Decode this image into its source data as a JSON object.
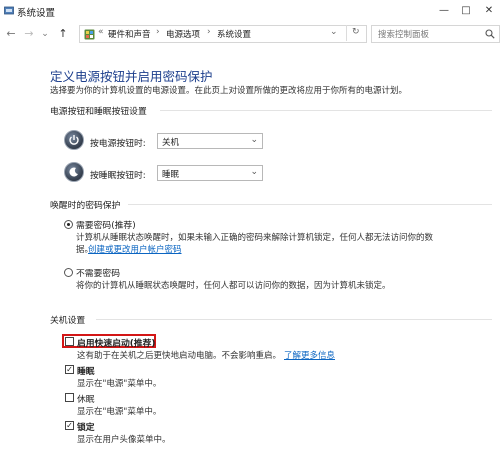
{
  "window": {
    "title": "系统设置",
    "minimize_label": "—",
    "maximize_label": "□",
    "close_label": "✕"
  },
  "nav": {
    "back_label": "←",
    "forward_label": "→",
    "recent_label": "⌄",
    "up_label": "↑",
    "breadcrumb_prefix": "«",
    "breadcrumb": [
      "硬件和声音",
      "电源选项",
      "系统设置"
    ],
    "breadcrumb_separator": "›",
    "dropdown_label": "⌄",
    "refresh_label": "↻",
    "search_placeholder": "搜索控制面板"
  },
  "page": {
    "heading": "定义电源按钮并启用密码保护",
    "description": "选择要为你的计算机设置的电源设置。在此页上对设置所做的更改将应用于你所有的电源计划。"
  },
  "buttons_section": {
    "title": "电源按钮和睡眠按钮设置",
    "power_button_label": "按电源按钮时:",
    "power_button_value": "关机",
    "sleep_button_label": "按睡眠按钮时:",
    "sleep_button_value": "睡眠"
  },
  "wakeup_section": {
    "title": "唤醒时的密码保护",
    "require_password": {
      "label": "需要密码(推荐)",
      "desc_line1": "计算机从睡眠状态唤醒时，如果未输入正确的密码来解除计算机锁定，任何人都无法访问你的数",
      "desc_line2": "据。",
      "link": "创建或更改用户帐户密码",
      "selected": true
    },
    "no_password": {
      "label": "不需要密码",
      "desc": "将你的计算机从睡眠状态唤醒时，任何人都可以访问你的数据，因为计算机未锁定。",
      "selected": false
    }
  },
  "shutdown_section": {
    "title": "关机设置",
    "items": [
      {
        "label": "启用快速启动(推荐)",
        "desc": "这有助于在关机之后更快地启动电脑。不会影响重启。",
        "link": "了解更多信息",
        "checked": false
      },
      {
        "label": "睡眠",
        "desc": "显示在\"电源\"菜单中。",
        "checked": true
      },
      {
        "label": "休眠",
        "desc": "显示在\"电源\"菜单中。",
        "checked": false
      },
      {
        "label": "锁定",
        "desc": "显示在用户头像菜单中。",
        "checked": true
      }
    ]
  },
  "colors": {
    "heading": "#1c3e8c",
    "link": "#0b65c2",
    "highlight_border": "#d31616"
  },
  "icons": [
    "settings-window-icon",
    "back-arrow-icon",
    "forward-arrow-icon",
    "recent-chevron-icon",
    "up-arrow-icon",
    "control-panel-icon",
    "refresh-icon",
    "search-icon",
    "power-button-icon",
    "sleep-button-icon"
  ]
}
